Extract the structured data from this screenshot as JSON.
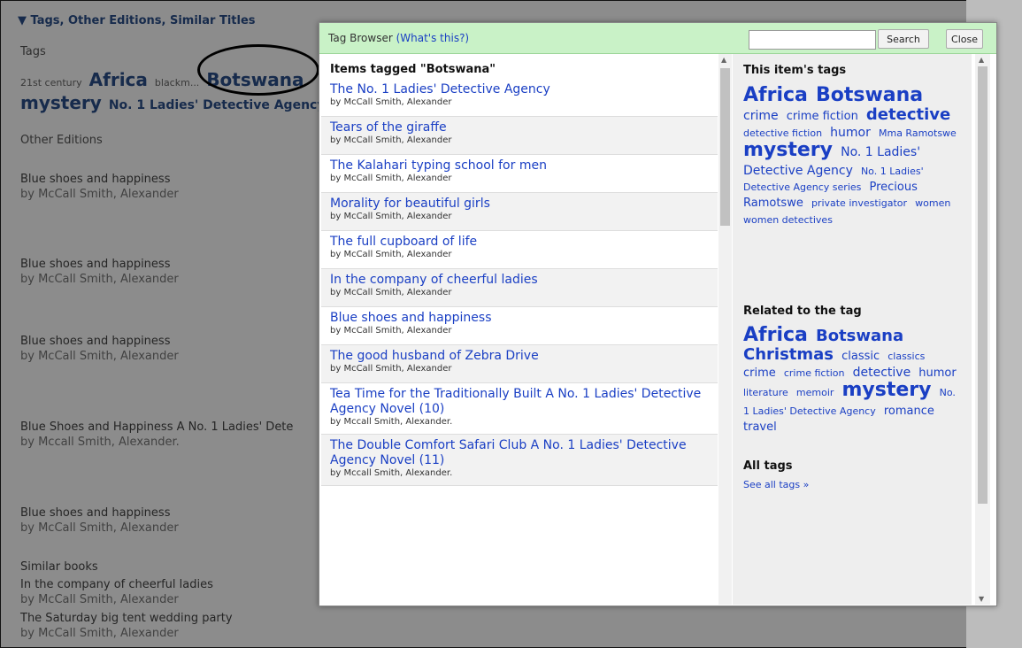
{
  "background": {
    "section_header": "▼ Tags, Other Editions, Similar Titles",
    "tags_label": "Tags",
    "tag_cloud_line1": [
      {
        "label": "21st century",
        "size": 1
      },
      {
        "label": "Africa",
        "size": 4
      },
      {
        "label": "blackm...",
        "size": 1
      },
      {
        "label": "Botswana",
        "size": 4
      }
    ],
    "tag_cloud_line2": [
      {
        "label": "mystery",
        "size": 4
      },
      {
        "label": "No. 1 Ladies' Detective Agency",
        "size": 3
      }
    ],
    "other_editions_label": "Other Editions",
    "editions": [
      {
        "title": "Blue shoes and happiness",
        "author": "by McCall Smith, Alexander"
      },
      {
        "title": "Blue shoes and happiness",
        "author": "by McCall Smith, Alexander"
      },
      {
        "title": "Blue shoes and happiness",
        "author": "by McCall Smith, Alexander"
      },
      {
        "title": "Blue Shoes and Happiness A No. 1 Ladies' Dete",
        "author": "by Mccall Smith, Alexander."
      },
      {
        "title": "Blue shoes and happiness",
        "author": "by McCall Smith, Alexander"
      }
    ],
    "similar_label": "Similar books",
    "similar": [
      {
        "title": "In the company of cheerful ladies",
        "author": "by McCall Smith, Alexander"
      },
      {
        "title": "The Saturday big tent wedding party",
        "author": "by McCall Smith, Alexander"
      }
    ]
  },
  "modal": {
    "title": "Tag Browser",
    "what_link": "(What's this?)",
    "search_value": "",
    "search_button": "Search",
    "close_button": "Close",
    "list_heading": "Items tagged \"Botswana\"",
    "items": [
      {
        "title": "The No. 1 Ladies' Detective Agency",
        "author": "by McCall Smith, Alexander"
      },
      {
        "title": "Tears of the giraffe",
        "author": "by McCall Smith, Alexander"
      },
      {
        "title": "The Kalahari typing school for men",
        "author": "by McCall Smith, Alexander"
      },
      {
        "title": "Morality for beautiful girls",
        "author": "by McCall Smith, Alexander"
      },
      {
        "title": "The full cupboard of life",
        "author": "by McCall Smith, Alexander"
      },
      {
        "title": "In the company of cheerful ladies",
        "author": "by McCall Smith, Alexander"
      },
      {
        "title": "Blue shoes and happiness",
        "author": "by McCall Smith, Alexander"
      },
      {
        "title": "The good husband of Zebra Drive",
        "author": "by McCall Smith, Alexander"
      },
      {
        "title": "Tea Time for the Traditionally Built A No. 1 Ladies' Detective Agency Novel (10)",
        "author": "by Mccall Smith, Alexander."
      },
      {
        "title": "The Double Comfort Safari Club A No. 1 Ladies' Detective Agency Novel (11)",
        "author": "by Mccall Smith, Alexander."
      }
    ],
    "item_tags_heading": "This item's tags",
    "item_tags": [
      {
        "label": "Africa",
        "size": 5
      },
      {
        "label": "Botswana",
        "size": 5
      },
      {
        "label": "crime",
        "size": 3
      },
      {
        "label": "crime fiction",
        "size": 2
      },
      {
        "label": "detective",
        "size": 4
      },
      {
        "label": "detective fiction",
        "size": 1
      },
      {
        "label": "humor",
        "size": 3
      },
      {
        "label": "Mma Ramotswe",
        "size": 1
      },
      {
        "label": "mystery",
        "size": 5
      },
      {
        "label": "No. 1 Ladies' Detective Agency",
        "size": 3
      },
      {
        "label": "No. 1 Ladies' Detective Agency series",
        "size": 1
      },
      {
        "label": "Precious Ramotswe",
        "size": 2
      },
      {
        "label": "private investigator",
        "size": 1
      },
      {
        "label": "women",
        "size": 1
      },
      {
        "label": "women detectives",
        "size": 1
      }
    ],
    "related_heading": "Related to the tag",
    "related_tags": [
      {
        "label": "Africa",
        "size": 5
      },
      {
        "label": "Botswana",
        "size": 4
      },
      {
        "label": "Christmas",
        "size": 4
      },
      {
        "label": "classic",
        "size": 2
      },
      {
        "label": "classics",
        "size": 1
      },
      {
        "label": "crime",
        "size": 2
      },
      {
        "label": "crime fiction",
        "size": 1
      },
      {
        "label": "detective",
        "size": 3
      },
      {
        "label": "humor",
        "size": 2
      },
      {
        "label": "literature",
        "size": 1
      },
      {
        "label": "memoir",
        "size": 1
      },
      {
        "label": "mystery",
        "size": 5
      },
      {
        "label": "No. 1 Ladies' Detective Agency",
        "size": 1
      },
      {
        "label": "romance",
        "size": 2
      },
      {
        "label": "travel",
        "size": 2
      }
    ],
    "all_tags_heading": "All tags",
    "see_all": "See all tags »"
  },
  "colors": {
    "link": "#1a3fc4",
    "modal_header": "#c9f2c7",
    "background_link": "#2a4f8a"
  }
}
